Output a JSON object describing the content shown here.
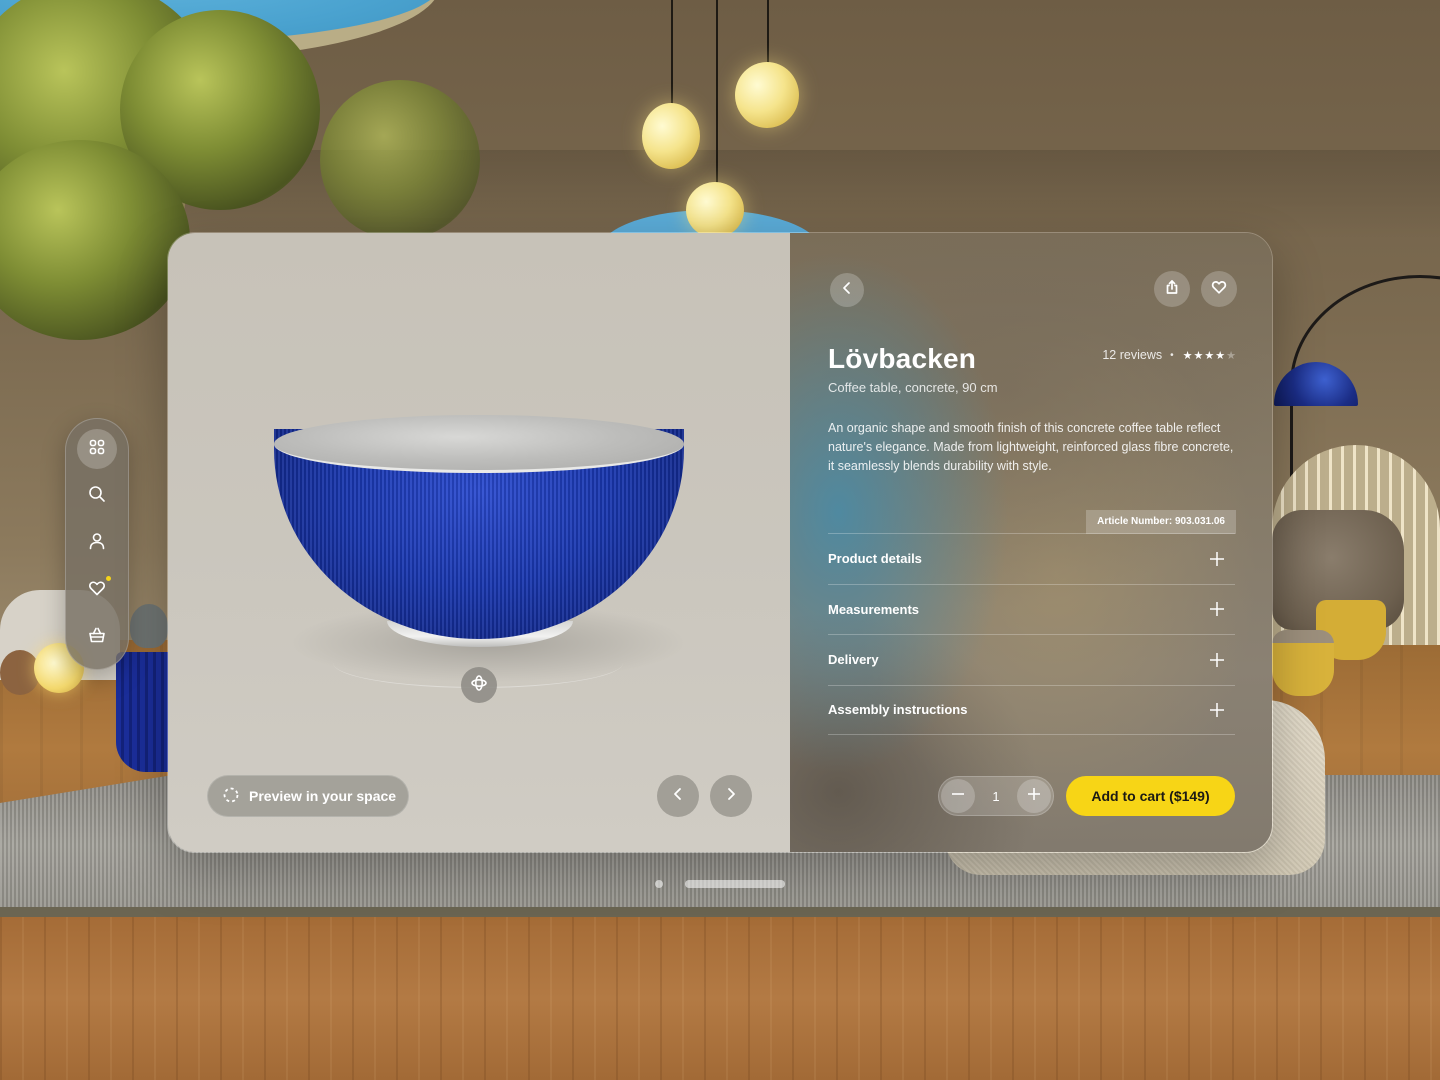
{
  "app": {
    "window_title": "Lövbacken"
  },
  "sidebar": {
    "items": [
      {
        "name": "browse",
        "icon": "grid-icon",
        "active": true
      },
      {
        "name": "search",
        "icon": "search-icon",
        "active": false
      },
      {
        "name": "profile",
        "icon": "user-icon",
        "active": false
      },
      {
        "name": "favorites",
        "icon": "heart-icon",
        "active": false,
        "has_badge": true
      },
      {
        "name": "cart",
        "icon": "basket-icon",
        "active": false
      }
    ],
    "badge_color": "#f5d31a"
  },
  "viewer": {
    "preview_label": "Preview in your space",
    "preview_icon": "ar-preview-icon",
    "rotate_icon": "rotate-3d-icon",
    "prev_icon": "chevron-left-icon",
    "next_icon": "chevron-right-icon"
  },
  "product": {
    "name": "Lövbacken",
    "subtitle": "Coffee table, concrete, 90 cm",
    "reviews_label": "12 reviews",
    "separator": "•",
    "rating": 4,
    "rating_max": 5,
    "description": "An organic shape and smooth finish of this concrete coffee table reflect nature's elegance. Made from lightweight, reinforced glass fibre concrete, it seamlessly blends durability with style.",
    "article_number": "Article Number: 903.031.06"
  },
  "header_actions": {
    "back_icon": "chevron-left-icon",
    "share_icon": "share-icon",
    "favorite_icon": "heart-icon"
  },
  "accordion": [
    {
      "label": "Product details"
    },
    {
      "label": "Measurements"
    },
    {
      "label": "Delivery"
    },
    {
      "label": "Assembly instructions"
    }
  ],
  "purchase": {
    "quantity": "1",
    "add_to_cart_label": "Add to cart ($149)",
    "accent_color": "#f7d516"
  }
}
